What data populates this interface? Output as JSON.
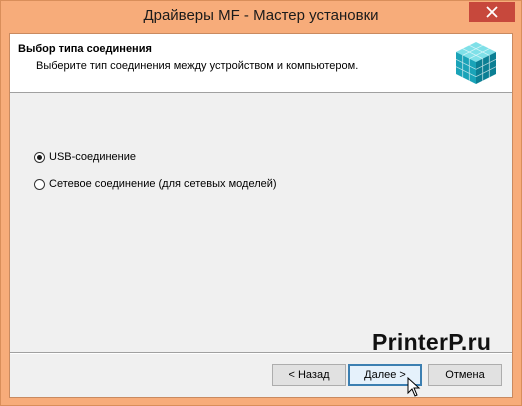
{
  "window": {
    "title": "Драйверы MF - Мастер установки"
  },
  "header": {
    "title": "Выбор типа соединения",
    "subtitle": "Выберите тип соединения между устройством и компьютером."
  },
  "options": [
    {
      "label": "USB-соединение",
      "selected": true
    },
    {
      "label": "Сетевое соединение (для сетевых моделей)",
      "selected": false
    }
  ],
  "watermark": "PrinterP.ru",
  "buttons": {
    "back": "< Назад",
    "next": "Далее >",
    "cancel": "Отмена"
  },
  "icons": {
    "close": "close-icon",
    "header": "cube-grid-icon",
    "cursor": "mouse-pointer-icon"
  },
  "colors": {
    "titlebar": "#f7ac7a",
    "close": "#c7483c",
    "accent": "#3c7fb1"
  }
}
